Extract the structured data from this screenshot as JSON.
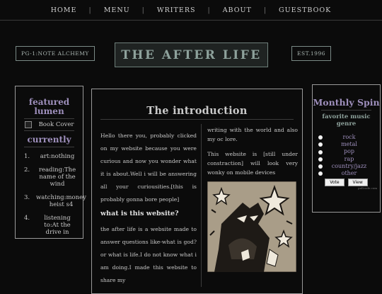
{
  "nav": {
    "items": [
      "HOME",
      "MENU",
      "WRITERS",
      "ABOUT",
      "GUESTBOOK"
    ],
    "separator": "|"
  },
  "header": {
    "left_tag": "PG-1:NOTE ALCHEMY",
    "title": "THE AFTER LIFE",
    "right_tag": "EST.1996"
  },
  "left_panel": {
    "featured_title": "featured lumen",
    "book_cover": "Book Cover",
    "currently_title": "currently",
    "items": [
      {
        "num": "1.",
        "text": "art:nothing"
      },
      {
        "num": "2.",
        "text": "reading:The name of the wind"
      },
      {
        "num": "3.",
        "text": "watching:money heist s4"
      },
      {
        "num": "4.",
        "text": "listening to:At the drive in"
      }
    ]
  },
  "main": {
    "title": "The introduction",
    "para1": "Hello there you, probably clicked on my website because you were curious and now you wonder what it is about.Well i will be answering all your curiousities.[this is probably gonna bore people]",
    "heading2": "what is this website?",
    "para2": "the after life is a website made to answer questions like-what is god? or what is life.I do not know what i am doing.I made this website to share my",
    "col2_para1": "writing with the world and also my oc lore.",
    "col2_para2": "This website is [still under constraction] will look very wonky on mobile devices"
  },
  "right_panel": {
    "title": "Monthly Spin",
    "poll_title": "favorite music genre",
    "options": [
      "rock",
      "metal",
      "pop",
      "rap",
      "country/jazz",
      "other"
    ],
    "vote_label": "Vote",
    "view_label": "View",
    "credit": "pollcode.com"
  },
  "colors": {
    "background": "#0b0b0b",
    "accent_purple": "#9e8fbc",
    "title_teal": "#8ea29c"
  }
}
